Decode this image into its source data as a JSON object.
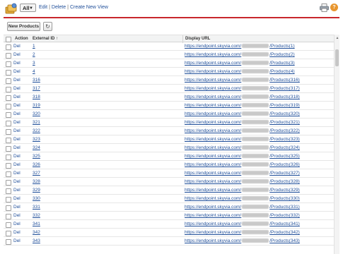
{
  "toolbar_top": {
    "view_selected": "All",
    "link_edit": "Edit",
    "link_delete": "Delete",
    "link_create": "Create New View",
    "separator": "|",
    "help_glyph": "?"
  },
  "actions": {
    "new_button_label": "New Products",
    "refresh_icon": "refresh-icon"
  },
  "table": {
    "headers": {
      "action": "Action",
      "external_id": "External ID",
      "sort_indicator": "↑",
      "display_url": "Display URL"
    },
    "rows": [
      {
        "action": "Del",
        "external_id": "1",
        "url_prefix": "https://endpoint.skyvia.com/",
        "url_suffix": "/Products(1)"
      },
      {
        "action": "Del",
        "external_id": "2",
        "url_prefix": "https://endpoint.skyvia.com/",
        "url_suffix": "/Products(2)"
      },
      {
        "action": "Del",
        "external_id": "3",
        "url_prefix": "https://endpoint.skyvia.com/",
        "url_suffix": "/Products(3)"
      },
      {
        "action": "Del",
        "external_id": "4",
        "url_prefix": "https://endpoint.skyvia.com/",
        "url_suffix": "/Products(4)"
      },
      {
        "action": "Del",
        "external_id": "316",
        "url_prefix": "https://endpoint.skyvia.com/",
        "url_suffix": "/Products(316)"
      },
      {
        "action": "Del",
        "external_id": "317",
        "url_prefix": "https://endpoint.skyvia.com/",
        "url_suffix": "/Products(317)"
      },
      {
        "action": "Del",
        "external_id": "318",
        "url_prefix": "https://endpoint.skyvia.com/",
        "url_suffix": "/Products(318)"
      },
      {
        "action": "Del",
        "external_id": "319",
        "url_prefix": "https://endpoint.skyvia.com/",
        "url_suffix": "/Products(319)"
      },
      {
        "action": "Del",
        "external_id": "320",
        "url_prefix": "https://endpoint.skyvia.com/",
        "url_suffix": "/Products(320)"
      },
      {
        "action": "Del",
        "external_id": "321",
        "url_prefix": "https://endpoint.skyvia.com/",
        "url_suffix": "/Products(321)"
      },
      {
        "action": "Del",
        "external_id": "322",
        "url_prefix": "https://endpoint.skyvia.com/",
        "url_suffix": "/Products(322)"
      },
      {
        "action": "Del",
        "external_id": "323",
        "url_prefix": "https://endpoint.skyvia.com/",
        "url_suffix": "/Products(323)"
      },
      {
        "action": "Del",
        "external_id": "324",
        "url_prefix": "https://endpoint.skyvia.com/",
        "url_suffix": "/Products(324)"
      },
      {
        "action": "Del",
        "external_id": "325",
        "url_prefix": "https://endpoint.skyvia.com/",
        "url_suffix": "/Products(325)"
      },
      {
        "action": "Del",
        "external_id": "326",
        "url_prefix": "https://endpoint.skyvia.com/",
        "url_suffix": "/Products(326)"
      },
      {
        "action": "Del",
        "external_id": "327",
        "url_prefix": "https://endpoint.skyvia.com/",
        "url_suffix": "/Products(327)"
      },
      {
        "action": "Del",
        "external_id": "328",
        "url_prefix": "https://endpoint.skyvia.com/",
        "url_suffix": "/Products(328)"
      },
      {
        "action": "Del",
        "external_id": "329",
        "url_prefix": "https://endpoint.skyvia.com/",
        "url_suffix": "/Products(329)"
      },
      {
        "action": "Del",
        "external_id": "330",
        "url_prefix": "https://endpoint.skyvia.com/",
        "url_suffix": "/Products(330)"
      },
      {
        "action": "Del",
        "external_id": "331",
        "url_prefix": "https://endpoint.skyvia.com/",
        "url_suffix": "/Products(331)"
      },
      {
        "action": "Del",
        "external_id": "332",
        "url_prefix": "https://endpoint.skyvia.com/",
        "url_suffix": "/Products(332)"
      },
      {
        "action": "Del",
        "external_id": "341",
        "url_prefix": "https://endpoint.skyvia.com/",
        "url_suffix": "/Products(341)"
      },
      {
        "action": "Del",
        "external_id": "342",
        "url_prefix": "https://endpoint.skyvia.com/",
        "url_suffix": "/Products(342)"
      },
      {
        "action": "Del",
        "external_id": "343",
        "url_prefix": "https://endpoint.skyvia.com/",
        "url_suffix": "/Products(343)"
      }
    ]
  },
  "colors": {
    "accent_rule": "#c8272d",
    "link": "#1f4e99",
    "header_bg": "#f2f3f3",
    "help_icon": "#e8962e"
  }
}
